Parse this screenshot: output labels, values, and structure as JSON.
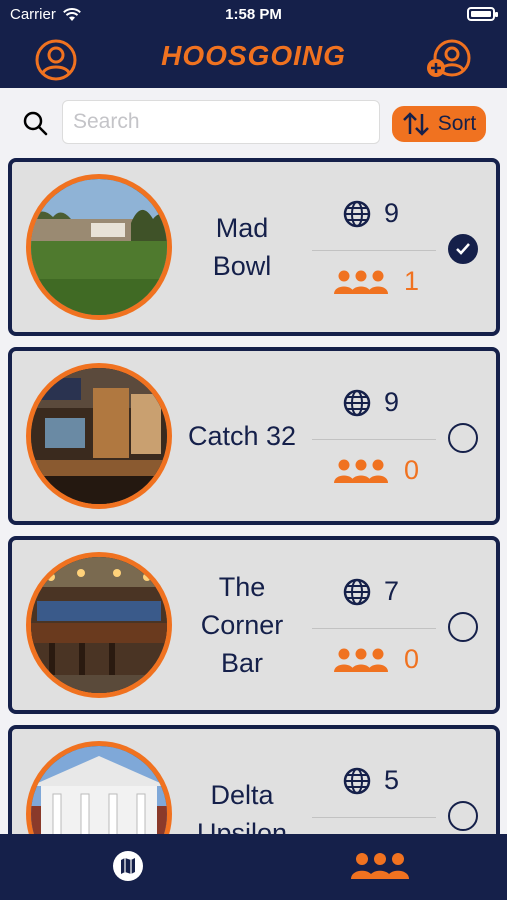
{
  "status_bar": {
    "carrier": "Carrier",
    "time": "1:58 PM"
  },
  "header": {
    "title": "HOOSGOING",
    "left_icon": "user-circle-icon",
    "right_icon": "add-user-icon"
  },
  "search": {
    "placeholder": "Search",
    "value": "",
    "sort_label": "Sort"
  },
  "places": [
    {
      "name": "Mad\nBowl",
      "global_count": "9",
      "group_count": "1",
      "selected": true
    },
    {
      "name": "Catch 32",
      "global_count": "9",
      "group_count": "0",
      "selected": false
    },
    {
      "name": "The\nCorner\nBar",
      "global_count": "7",
      "group_count": "0",
      "selected": false
    },
    {
      "name": "Delta\nUpsilon",
      "global_count": "5",
      "group_count": "",
      "selected": false
    }
  ],
  "tabs": [
    {
      "name": "map",
      "icon": "map-icon",
      "active": false
    },
    {
      "name": "groups",
      "icon": "group-icon",
      "active": true
    }
  ],
  "colors": {
    "navy": "#15204a",
    "orange": "#f07220",
    "card": "#e0e0e0",
    "background": "#f2f2f5"
  }
}
